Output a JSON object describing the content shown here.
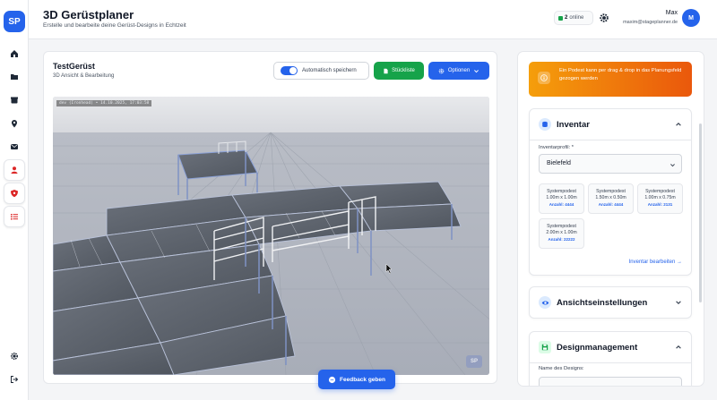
{
  "app": {
    "logo": "SP",
    "title": "3D Gerüstplaner",
    "subtitle": "Erstelle und bearbeite deine Gerüst-Designs in Echtzeit"
  },
  "header": {
    "online_count": "2",
    "online_label": "online",
    "user_name": "Max",
    "user_email": "maxim@stageplanner.de",
    "avatar_initial": "M"
  },
  "sidebar": {
    "items": [
      {
        "icon": "home-icon"
      },
      {
        "icon": "folder-icon"
      },
      {
        "icon": "box-icon"
      },
      {
        "icon": "map-pin-icon"
      },
      {
        "icon": "mail-icon"
      },
      {
        "icon": "user-icon"
      },
      {
        "icon": "shield-icon"
      },
      {
        "icon": "list-icon"
      }
    ],
    "bottom": [
      {
        "icon": "gear-icon"
      },
      {
        "icon": "logout-icon"
      }
    ]
  },
  "main": {
    "project_title": "TestGerüst",
    "project_subtitle": "3D Ansicht & Bearbeitung",
    "autosave_label": "Automatisch speichern",
    "autosave_on": true,
    "parts_list_label": "Stückliste",
    "options_label": "Optionen",
    "viewport_info": "dev (Ironhead) • 14.10.2025, 17:03:58",
    "viewport_logo": "SP"
  },
  "feedback_label": "Feedback geben",
  "panel": {
    "alert_text": "Ein Podest kann per drag & drop in das Planungsfeld gezogen werden",
    "inventory": {
      "title": "Inventar",
      "profile_label": "Inventarprofil: *",
      "profile_value": "Bielefeld",
      "items": [
        {
          "name": "Systempodest",
          "size": "1.00m x 1.00m",
          "count": "Anzahl: 4444"
        },
        {
          "name": "Systempodest",
          "size": "1.50m x 0.50m",
          "count": "Anzahl: 4444"
        },
        {
          "name": "Systempodest",
          "size": "1.00m x 0.75m",
          "count": "Anzahl: 2131"
        },
        {
          "name": "Systempodest",
          "size": "2.00m x 1.00m",
          "count": "Anzahl: 22222"
        }
      ],
      "edit_link": "Inventar bearbeiten →"
    },
    "view_settings": {
      "title": "Ansichtseinstellungen"
    },
    "design_mgmt": {
      "title": "Designmanagement",
      "name_label": "Name des Designs:"
    }
  },
  "colors": {
    "primary": "#2563eb",
    "success": "#16a34a",
    "alert_start": "#f59e0b",
    "alert_end": "#ea580c",
    "active_nav": "#dc2626"
  }
}
